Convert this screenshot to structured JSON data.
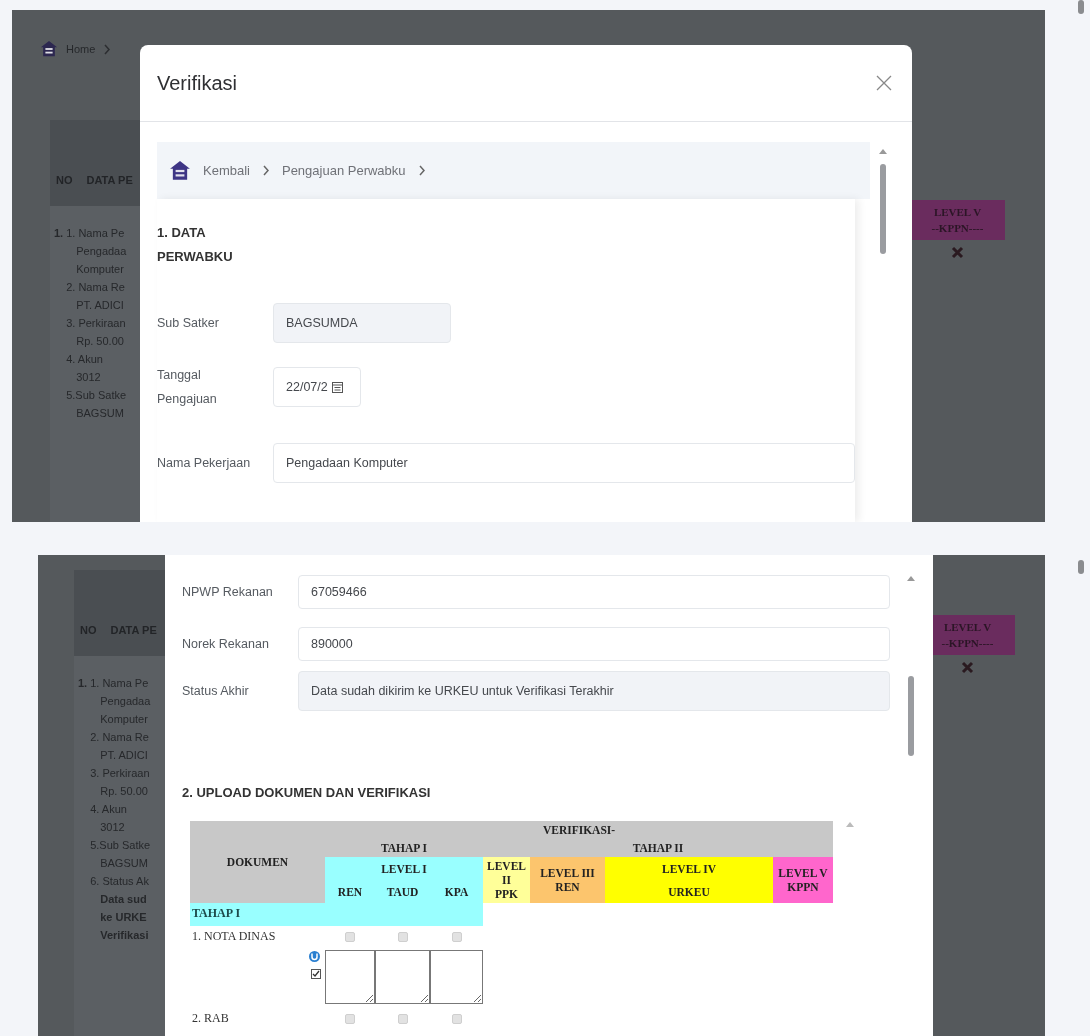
{
  "top_view": {
    "background_page": {
      "breadcrumb": {
        "label": "Home"
      },
      "table_header": [
        "NO",
        "DATA PE"
      ],
      "row_number": "1.",
      "items": [
        {
          "label": "1. Nama Pe",
          "value_lines": [
            "Pengadaa",
            "Komputer"
          ],
          "bold": false
        },
        {
          "label": "2. Nama Re",
          "value_lines": [
            "PT. ADICI"
          ],
          "bold": false
        },
        {
          "label": "3. Perkiraan",
          "value_lines": [
            "Rp. 50.00"
          ],
          "bold": false
        },
        {
          "label": "4. Akun",
          "value_lines": [
            "3012"
          ],
          "bold": false
        },
        {
          "label": "5.Sub Satke",
          "value_lines": [
            "BAGSUM"
          ],
          "bold": false
        }
      ],
      "level_badge": {
        "title": "LEVEL V",
        "subtitle": "--KPPN----"
      }
    },
    "modal": {
      "title": "Verifikasi",
      "breadcrumb": [
        "Kembali",
        "Pengajuan Perwabku"
      ],
      "section_title": "1. DATA PERWABKU",
      "fields": [
        {
          "label": "Sub Satker",
          "value": "BAGSUMDA",
          "kind": "readonly"
        },
        {
          "label": "Tanggal Pengajuan",
          "value": "22/07/2",
          "kind": "date"
        },
        {
          "label": "Nama Pekerjaan",
          "value": "Pengadaan Komputer",
          "kind": "text"
        }
      ]
    }
  },
  "bottom_view": {
    "background_page": {
      "table_header": [
        "NO",
        "DATA PE"
      ],
      "row_number": "1.",
      "items": [
        {
          "label": "1. Nama Pe",
          "value_lines": [
            "Pengadaa",
            "Komputer"
          ],
          "bold": false
        },
        {
          "label": "2. Nama Re",
          "value_lines": [
            "PT. ADICI"
          ],
          "bold": false
        },
        {
          "label": "3. Perkiraan",
          "value_lines": [
            "Rp. 50.00"
          ],
          "bold": false
        },
        {
          "label": "4. Akun",
          "value_lines": [
            "3012"
          ],
          "bold": false
        },
        {
          "label": "5.Sub Satke",
          "value_lines": [
            "BAGSUM"
          ],
          "bold": false
        },
        {
          "label": "6. Status Ak",
          "value_lines": [
            "Data sud",
            "ke URKE",
            "Verifikasi"
          ],
          "bold": true
        }
      ],
      "level_badge": {
        "title": "LEVEL V",
        "subtitle": "--KPPN----"
      }
    },
    "modal": {
      "fields": [
        {
          "label": "NPWP Rekanan",
          "value": "67059466",
          "kind": "text"
        },
        {
          "label": "Norek Rekanan",
          "value": "890000",
          "kind": "text"
        },
        {
          "label": "Status Akhir",
          "value": "Data sudah dikirim ke URKEU untuk Verifikasi Terakhir",
          "kind": "readonly"
        }
      ],
      "section_title": "2. UPLOAD DOKUMEN DAN VERIFIKASI",
      "verification_table": {
        "document_header": "DOKUMEN",
        "title": "VERIFIKASI-",
        "stages": [
          {
            "label": "TAHAP I",
            "levels": [
              {
                "label": "LEVEL I",
                "kind": "grouped",
                "color": "#99ffff",
                "roles": [
                  "REN",
                  "TAUD",
                  "KPA"
                ]
              }
            ]
          },
          {
            "label": "TAHAP II",
            "levels": [
              {
                "label": "LEVEL II",
                "kind": "stacked",
                "color": "#ffff99",
                "roles": [
                  "PPK"
                ]
              },
              {
                "label": "LEVEL III",
                "kind": "stacked",
                "color": "#fcc56d",
                "roles": [
                  "REN"
                ]
              },
              {
                "label": "LEVEL IV",
                "kind": "grouped",
                "color": "#ffff00",
                "roles": [
                  "URKEU"
                ]
              },
              {
                "label": "LEVEL V",
                "kind": "stacked",
                "color": "#ff66cc",
                "roles": [
                  "KPPN"
                ]
              }
            ]
          }
        ],
        "sections": [
          {
            "label": "TAHAP I",
            "documents": [
              {
                "name": "1. NOTA DINAS",
                "show_notes": true,
                "checks": [
                  {
                    "checked": false,
                    "disabled": true
                  },
                  {
                    "checked": false,
                    "disabled": true
                  },
                  {
                    "checked": false,
                    "disabled": true
                  }
                ]
              },
              {
                "name": "2. RAB",
                "show_notes": false,
                "checks": [
                  {
                    "checked": false,
                    "disabled": true
                  },
                  {
                    "checked": false,
                    "disabled": true
                  },
                  {
                    "checked": false,
                    "disabled": true
                  }
                ]
              }
            ]
          }
        ]
      }
    }
  }
}
